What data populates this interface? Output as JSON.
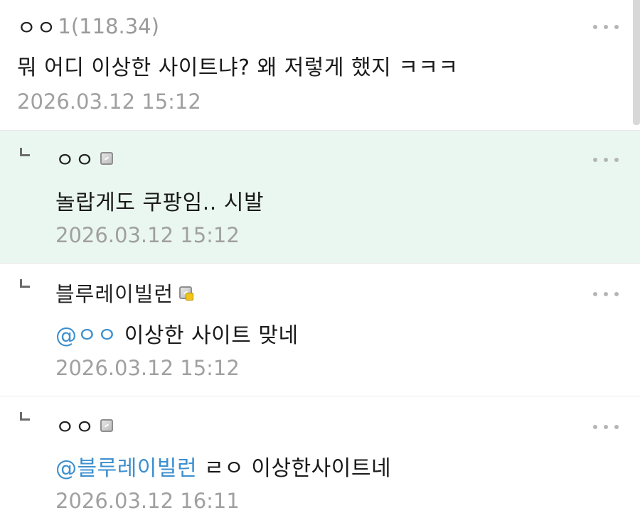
{
  "comments": [
    {
      "author": "ㅇㅇ",
      "ip": "1(118.34)",
      "text": "뭐 어디 이상한 사이트냐? 왜 저렇게 했지 ㅋㅋㅋ",
      "mention": "",
      "timestamp": "2026.03.12 15:12",
      "is_reply": false,
      "highlighted": false,
      "more_icon": "more-dots-icon"
    },
    {
      "author": "ㅇㅇ",
      "badge_icon": "fixed-nick-icon",
      "text": "놀랍게도 쿠팡임.. 시발",
      "mention": "",
      "timestamp": "2026.03.12 15:12",
      "is_reply": true,
      "highlighted": true,
      "more_icon": "more-dots-icon"
    },
    {
      "author": "블루레이빌런",
      "badge_icon": "fixed-nick-gold-icon",
      "text": " 이상한 사이트 맞네",
      "mention": "@ㅇㅇ",
      "timestamp": "2026.03.12 15:12",
      "is_reply": true,
      "highlighted": false,
      "more_icon": "more-dots-icon"
    },
    {
      "author": "ㅇㅇ",
      "badge_icon": "fixed-nick-icon",
      "text": " ㄹㅇ 이상한사이트네",
      "mention": "@블루레이빌런",
      "timestamp": "2026.03.12 16:11",
      "is_reply": true,
      "highlighted": false,
      "more_icon": "more-dots-icon"
    }
  ],
  "colors": {
    "highlight_bg": "#eaf7f0",
    "mention": "#3c8fcf",
    "timestamp": "#a0a0a0"
  }
}
